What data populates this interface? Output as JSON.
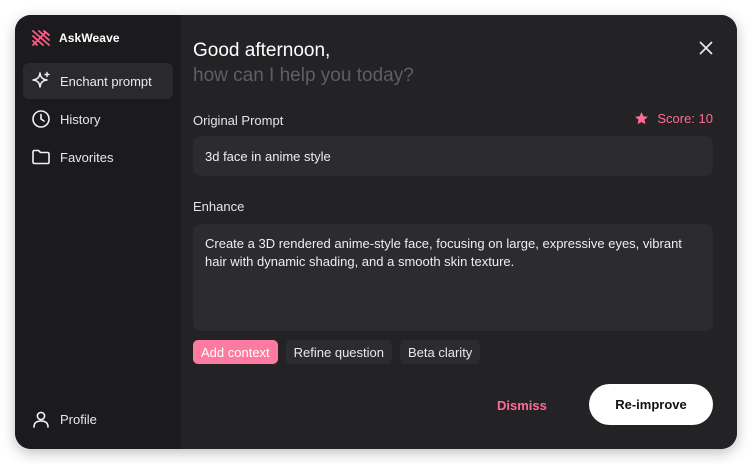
{
  "app": {
    "name": "AskWeave",
    "logo_icon": "askweave-logo-icon"
  },
  "colors": {
    "accent": "#ff6b95",
    "chip_active": "#ff7aa0",
    "panel": "#232326",
    "sidebar": "#1b1b1d"
  },
  "sidebar": {
    "items": [
      {
        "label": "Enchant prompt",
        "icon": "sparkle-icon",
        "active": true
      },
      {
        "label": "History",
        "icon": "clock-icon",
        "active": false
      },
      {
        "label": "Favorites",
        "icon": "folder-icon",
        "active": false
      }
    ],
    "profile": {
      "label": "Profile",
      "icon": "user-icon"
    }
  },
  "main": {
    "greeting": "Good afternoon,",
    "subgreeting": "how can I help you today?",
    "original_label": "Original Prompt",
    "score_label": "Score: 10",
    "original_prompt": "3d face in anime style",
    "enhance_label": "Enhance",
    "enhanced_text": "Create a 3D rendered anime-style face, focusing on large, expressive eyes, vibrant hair with dynamic shading, and a smooth skin texture.",
    "chips": [
      "Add context",
      "Refine question",
      "Beta clarity"
    ],
    "active_chip": "Add context",
    "dismiss_label": "Dismiss",
    "reimprove_label": "Re-improve"
  }
}
